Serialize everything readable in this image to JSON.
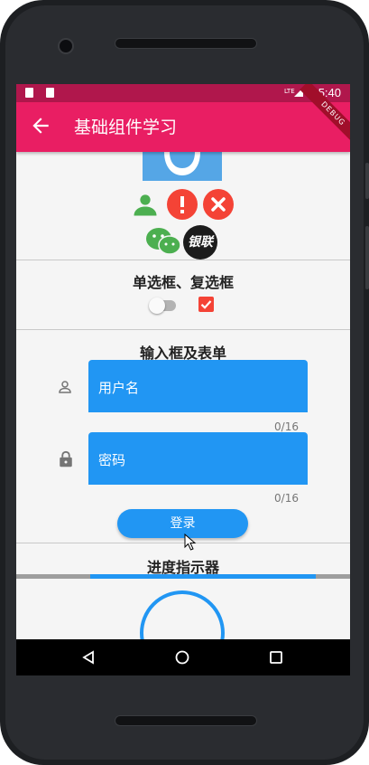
{
  "status_bar": {
    "time": "5:40"
  },
  "app_bar": {
    "title": "基础组件学习",
    "debug_banner": "DEBUG"
  },
  "sections": {
    "radio_checkbox": {
      "title": "单选框、复选框",
      "switch_on": false,
      "checkbox_checked": true
    },
    "form": {
      "title": "输入框及表单",
      "username_placeholder": "用户名",
      "username_counter": "0/16",
      "password_placeholder": "密码",
      "password_counter": "0/16",
      "login_label": "登录"
    },
    "progress": {
      "title": "进度指示器"
    }
  },
  "icons": {
    "unionpay_text": "银联"
  },
  "colors": {
    "primary": "#e91e63",
    "status_bar": "#b0174c",
    "accent": "#2196f3",
    "error": "#f44336",
    "green": "#4caf50"
  }
}
